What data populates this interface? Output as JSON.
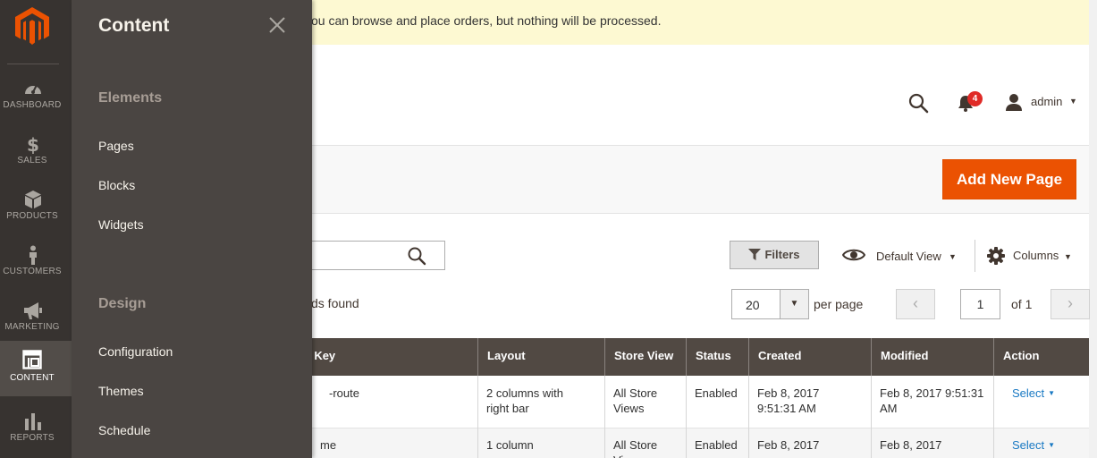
{
  "notice": {
    "text": "ou can browse and place orders, but nothing will be processed."
  },
  "header": {
    "notifications_count": "4",
    "user_name": "admin"
  },
  "actions": {
    "add_new_page": "Add New Page"
  },
  "toolbar": {
    "filters": "Filters",
    "view": "Default View",
    "columns": "Columns",
    "records_found": "ds found",
    "per_page_value": "20",
    "per_page_label": "per page",
    "page_value": "1",
    "of_pages": "of 1"
  },
  "grid": {
    "columns": [
      "L Key",
      "Layout",
      "Store View",
      "Status",
      "Created",
      "Modified",
      "Action"
    ],
    "rows": [
      {
        "url_key": "-route",
        "layout": "2 columns with right bar",
        "store_view": "All Store Views",
        "status": "Enabled",
        "created": "Feb 8, 2017 9:51:31 AM",
        "modified": "Feb 8, 2017 9:51:31 AM",
        "action": "Select"
      },
      {
        "url_key": "me",
        "layout": "1 column",
        "store_view": "All Store Views",
        "status": "Enabled",
        "created": "Feb 8, 2017",
        "modified": "Feb 8, 2017",
        "action": "Select"
      }
    ]
  },
  "nav": {
    "items": [
      {
        "label": "DASHBOARD",
        "icon": "dashboard-icon"
      },
      {
        "label": "SALES",
        "icon": "dollar-icon"
      },
      {
        "label": "PRODUCTS",
        "icon": "box-icon"
      },
      {
        "label": "CUSTOMERS",
        "icon": "person-icon"
      },
      {
        "label": "MARKETING",
        "icon": "megaphone-icon"
      },
      {
        "label": "CONTENT",
        "icon": "layout-icon"
      },
      {
        "label": "REPORTS",
        "icon": "bar-chart-icon"
      }
    ]
  },
  "flyout": {
    "title": "Content",
    "sections": [
      {
        "title": "Elements",
        "links": [
          "Pages",
          "Blocks",
          "Widgets"
        ]
      },
      {
        "title": "Design",
        "links": [
          "Configuration",
          "Themes",
          "Schedule"
        ]
      }
    ]
  },
  "colors": {
    "accent": "#eb5202",
    "nav_bg": "#373330",
    "flyout_bg": "#4a4542",
    "grid_header": "#514943",
    "link": "#1979c3",
    "notice_bg": "#fdf9d2"
  }
}
